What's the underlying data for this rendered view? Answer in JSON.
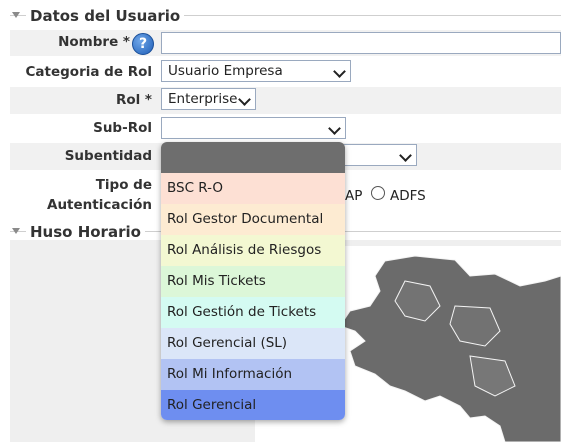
{
  "user_section": {
    "legend": "Datos del Usuario",
    "fields": {
      "nombre_label": "Nombre *",
      "categoria_label": "Categoria de Rol",
      "categoria_value": "Usuario Empresa",
      "rol_label": "Rol *",
      "rol_value": "Enterprise",
      "subrol_label": "Sub-Rol",
      "subentidad_label": "Subentidad",
      "tipo_label_line1": "Tipo de",
      "tipo_label_line2": "Autenticación",
      "tipo_partial_text": "AP",
      "adfs_label": "ADFS"
    }
  },
  "timezone_section": {
    "legend": "Huso Horario"
  },
  "subrol_dropdown": {
    "options": [
      {
        "label": "BSC R-O",
        "color": "#fde0d4"
      },
      {
        "label": "Rol Gestor Documental",
        "color": "#fdebd2"
      },
      {
        "label": "Rol Análisis de Riesgos",
        "color": "#f3f8d2"
      },
      {
        "label": "Rol Mis Tickets",
        "color": "#dcf7d8"
      },
      {
        "label": "Rol Gestión de Tickets",
        "color": "#d4fbf2"
      },
      {
        "label": "Rol Gerencial (SL)",
        "color": "#dbe6f8"
      },
      {
        "label": "Rol Mi Información",
        "color": "#b2c3f3"
      },
      {
        "label": "Rol Gerencial",
        "color": "#6e8ef0"
      }
    ]
  },
  "help_icon": "question-mark-icon"
}
